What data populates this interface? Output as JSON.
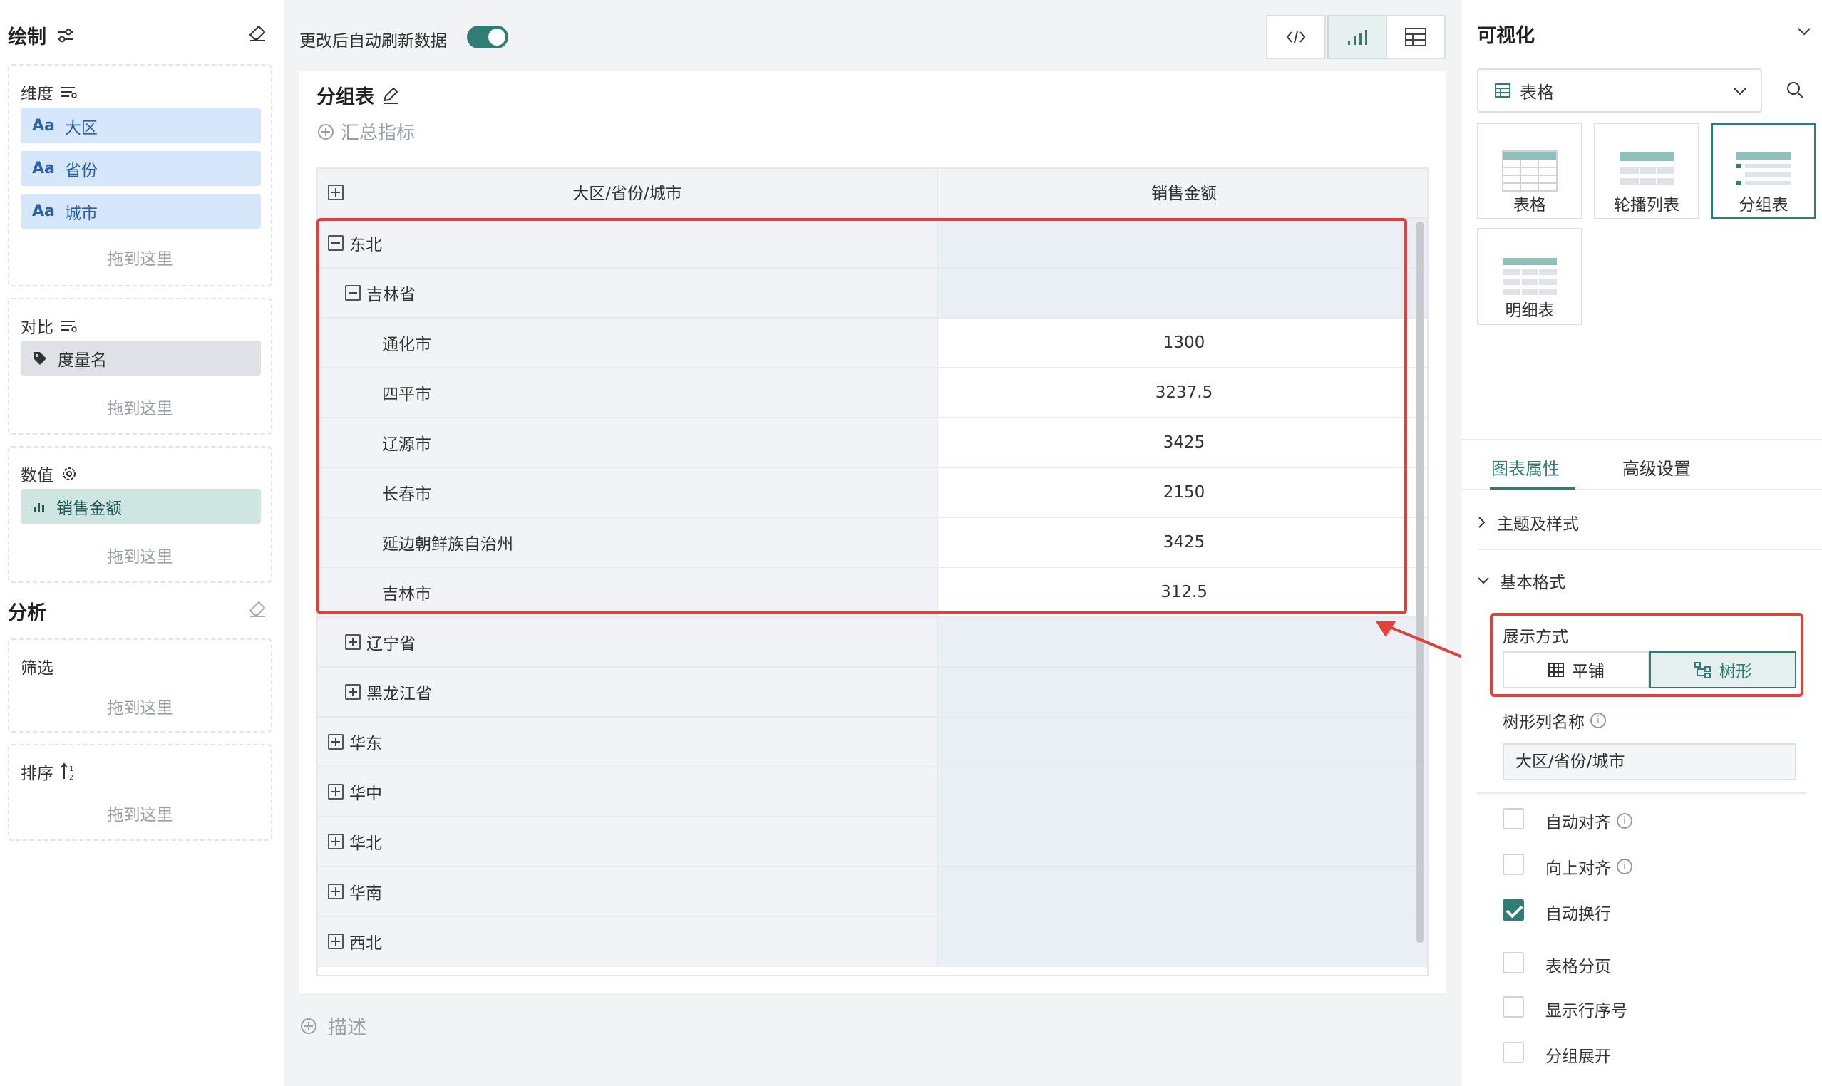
{
  "left": {
    "draw_title": "绘制",
    "dimension": {
      "label": "维度",
      "items": [
        "大区",
        "省份",
        "城市"
      ],
      "item_prefix": "Aa",
      "drop": "拖到这里"
    },
    "compare": {
      "label": "对比",
      "items": [
        "度量名"
      ],
      "drop": "拖到这里"
    },
    "value": {
      "label": "数值",
      "items": [
        "销售金额"
      ],
      "drop": "拖到这里"
    },
    "analysis_title": "分析",
    "filter": {
      "label": "筛选",
      "drop": "拖到这里"
    },
    "sort": {
      "label": "排序",
      "drop": "拖到这里"
    }
  },
  "center": {
    "auto_refresh_label": "更改后自动刷新数据",
    "auto_refresh_on": true,
    "chart_title": "分组表",
    "summary_label": "汇总指标",
    "describe_label": "描述",
    "table": {
      "columns": [
        "大区/省份/城市",
        "销售金额"
      ],
      "rows": [
        {
          "label": "东北",
          "level": 0,
          "state": "expanded",
          "value": ""
        },
        {
          "label": "吉林省",
          "level": 1,
          "state": "expanded",
          "value": ""
        },
        {
          "label": "通化市",
          "level": 2,
          "state": "leaf",
          "value": "1300"
        },
        {
          "label": "四平市",
          "level": 2,
          "state": "leaf",
          "value": "3237.5"
        },
        {
          "label": "辽源市",
          "level": 2,
          "state": "leaf",
          "value": "3425"
        },
        {
          "label": "长春市",
          "level": 2,
          "state": "leaf",
          "value": "2150"
        },
        {
          "label": "延边朝鲜族自治州",
          "level": 2,
          "state": "leaf",
          "value": "3425"
        },
        {
          "label": "吉林市",
          "level": 2,
          "state": "leaf",
          "value": "312.5"
        },
        {
          "label": "辽宁省",
          "level": 1,
          "state": "collapsed",
          "value": ""
        },
        {
          "label": "黑龙江省",
          "level": 1,
          "state": "collapsed",
          "value": ""
        },
        {
          "label": "华东",
          "level": 0,
          "state": "collapsed",
          "value": ""
        },
        {
          "label": "华中",
          "level": 0,
          "state": "collapsed",
          "value": ""
        },
        {
          "label": "华北",
          "level": 0,
          "state": "collapsed",
          "value": ""
        },
        {
          "label": "华南",
          "level": 0,
          "state": "collapsed",
          "value": ""
        },
        {
          "label": "西北",
          "level": 0,
          "state": "collapsed",
          "value": ""
        }
      ]
    }
  },
  "right": {
    "title": "可视化",
    "chart_type_selected": "表格",
    "types": [
      {
        "label": "表格"
      },
      {
        "label": "轮播列表"
      },
      {
        "label": "分组表"
      },
      {
        "label": "明细表"
      }
    ],
    "tabs": [
      "图表属性",
      "高级设置"
    ],
    "theme_section": "主题及样式",
    "basic_section": "基本格式",
    "display_mode_label": "展示方式",
    "display_modes": [
      "平铺",
      "树形"
    ],
    "display_mode_selected": "树形",
    "tree_col_name_label": "树形列名称",
    "tree_col_name_value": "大区/省份/城市",
    "options": [
      {
        "label": "自动对齐",
        "checked": false,
        "info": true
      },
      {
        "label": "向上对齐",
        "checked": false,
        "info": true
      },
      {
        "label": "自动换行",
        "checked": true,
        "info": false
      },
      {
        "label": "表格分页",
        "checked": false,
        "info": false
      },
      {
        "label": "显示行序号",
        "checked": false,
        "info": false
      },
      {
        "label": "分组展开",
        "checked": false,
        "info": false
      }
    ],
    "accent_color": "#2f7d74",
    "highlight_color": "#e0413b"
  }
}
